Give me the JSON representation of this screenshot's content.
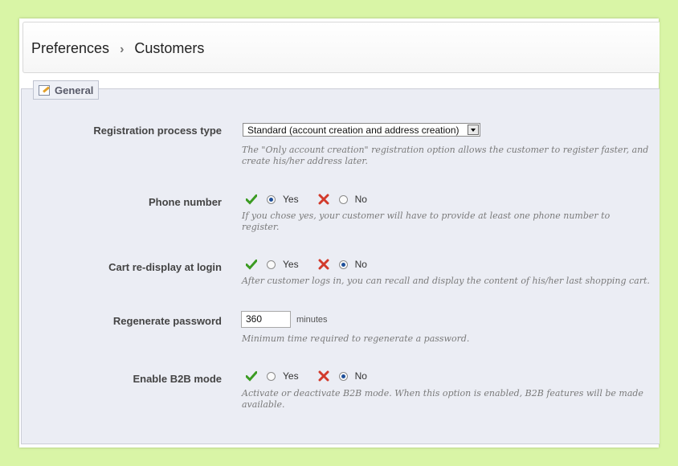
{
  "breadcrumb": {
    "root": "Preferences",
    "separator": "›",
    "current": "Customers"
  },
  "panel": {
    "legend_label": "General",
    "legend_icon": "edit-icon"
  },
  "fields": {
    "registration_type": {
      "label": "Registration process type",
      "selected": "Standard (account creation and address creation)",
      "hint": "The \"Only account creation\" registration option allows the customer to register faster, and create his/her address later."
    },
    "phone_number": {
      "label": "Phone number",
      "yes": "Yes",
      "no": "No",
      "value": "yes",
      "hint": "If you chose yes, your customer will have to provide at least one phone number to register."
    },
    "cart_redisplay": {
      "label": "Cart re-display at login",
      "yes": "Yes",
      "no": "No",
      "value": "no",
      "hint": "After customer logs in, you can recall and display the content of his/her last shopping cart."
    },
    "regenerate_password": {
      "label": "Regenerate password",
      "value": "360",
      "unit": "minutes",
      "hint": "Minimum time required to regenerate a password."
    },
    "b2b_mode": {
      "label": "Enable B2B mode",
      "yes": "Yes",
      "no": "No",
      "value": "no",
      "hint": "Activate or deactivate B2B mode. When this option is enabled, B2B features will be made available."
    }
  },
  "colors": {
    "background": "#d9f5a6",
    "panel": "#ebedf4",
    "check": "#3b9b22",
    "cross": "#d23a2b"
  }
}
